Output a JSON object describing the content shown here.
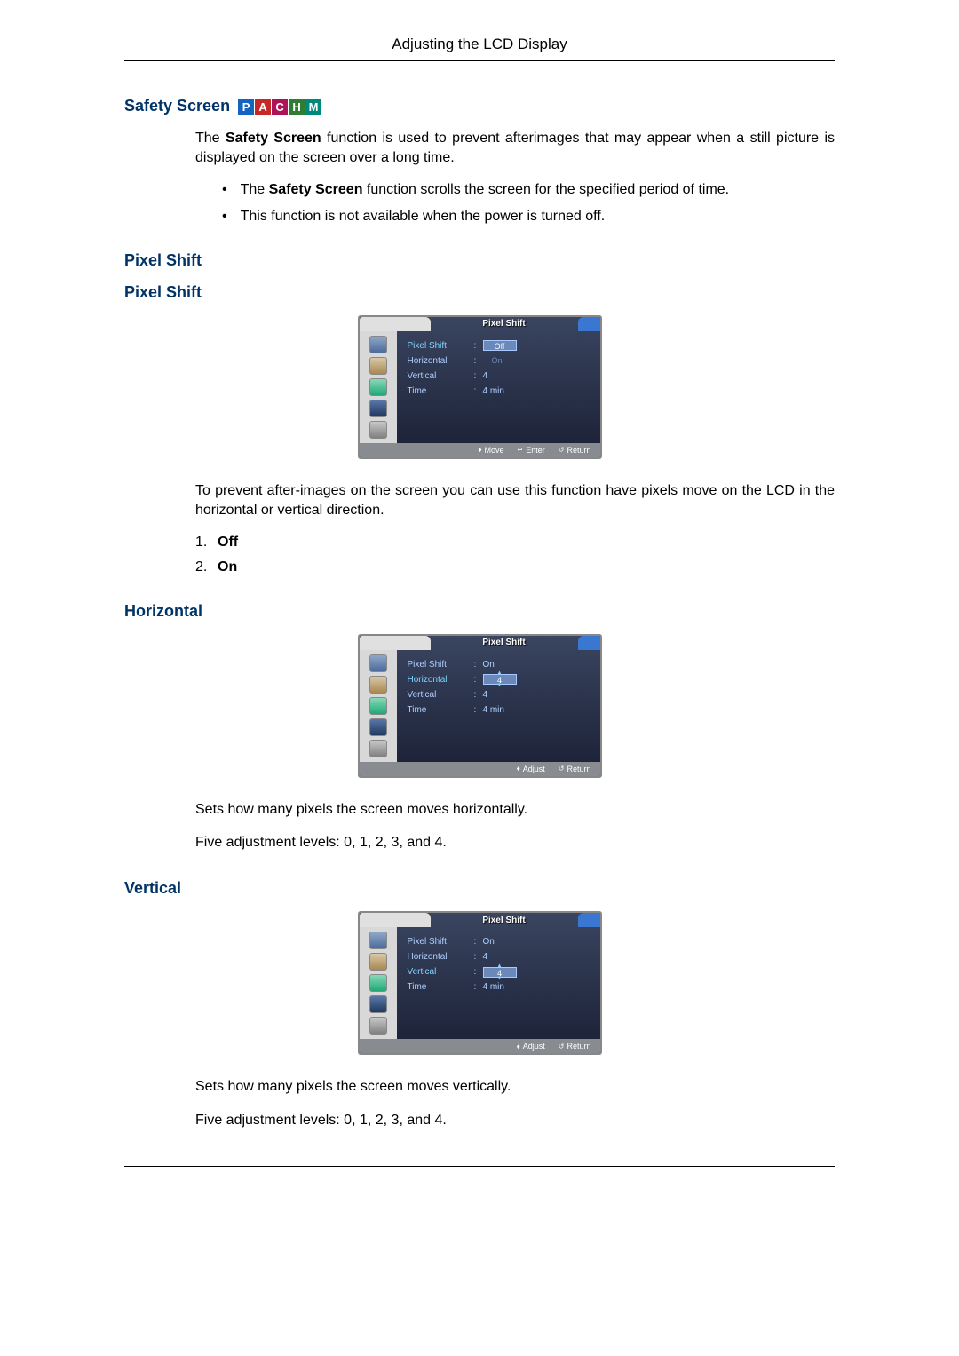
{
  "page_header": "Adjusting the LCD Display",
  "safety_screen": {
    "title": "Safety Screen",
    "badges": [
      "P",
      "A",
      "C",
      "H",
      "M"
    ],
    "intro": "The Safety Screen function is used to prevent afterimages that may appear when a still picture is displayed on the screen over a long time.",
    "bullet1_prefix": "The ",
    "bullet1_bold": "Safety Screen",
    "bullet1_suffix": " function scrolls the screen for the specified period of time.",
    "bullet2": "This function is not available when the power is turned off."
  },
  "pixel_shift": {
    "title1": "Pixel Shift",
    "title2": "Pixel Shift",
    "osd_title": "Pixel Shift",
    "rows": {
      "pixel_shift": "Pixel Shift",
      "horizontal": "Horizontal",
      "vertical": "Vertical",
      "time": "Time"
    },
    "osd1": {
      "selected_value": "Off",
      "option_below": "On",
      "vertical_val": "4",
      "time_val": "4 min",
      "footer": {
        "move": "Move",
        "enter": "Enter",
        "return": "Return"
      }
    },
    "desc": "To prevent after-images on the screen you can use this function have pixels move on the LCD in the horizontal or vertical direction.",
    "options": {
      "off": "Off",
      "on": "On"
    }
  },
  "horizontal": {
    "title": "Horizontal",
    "osd": {
      "pixel_shift_val": "On",
      "horizontal_val": "4",
      "vertical_val": "4",
      "time_val": "4 min",
      "footer": {
        "adjust": "Adjust",
        "return": "Return"
      }
    },
    "desc1": "Sets how many pixels the screen moves horizontally.",
    "desc2": "Five adjustment levels: 0, 1, 2, 3, and 4."
  },
  "vertical": {
    "title": "Vertical",
    "osd": {
      "pixel_shift_val": "On",
      "horizontal_val": "4",
      "vertical_val": "4",
      "time_val": "4 min",
      "footer": {
        "adjust": "Adjust",
        "return": "Return"
      }
    },
    "desc1": "Sets how many pixels the screen moves vertically.",
    "desc2": "Five adjustment levels: 0, 1, 2, 3, and 4."
  }
}
